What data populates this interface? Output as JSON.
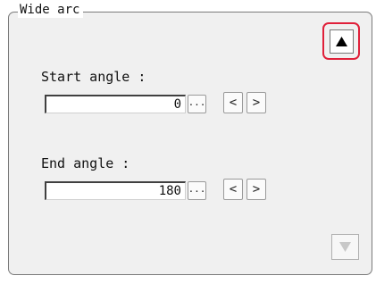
{
  "panel": {
    "title": "Wide arc",
    "scroll_up_icon": "triangle-up-icon",
    "scroll_down_icon": "triangle-down-icon"
  },
  "start_angle": {
    "label": "Start angle :",
    "value": "0",
    "ellipsis_label": "...",
    "decrement_label": "<",
    "increment_label": ">"
  },
  "end_angle": {
    "label": "End angle :",
    "value": "180",
    "ellipsis_label": "...",
    "decrement_label": "<",
    "increment_label": ">"
  },
  "colors": {
    "highlight": "#e0203a",
    "panel_bg": "#f0f0f0"
  }
}
